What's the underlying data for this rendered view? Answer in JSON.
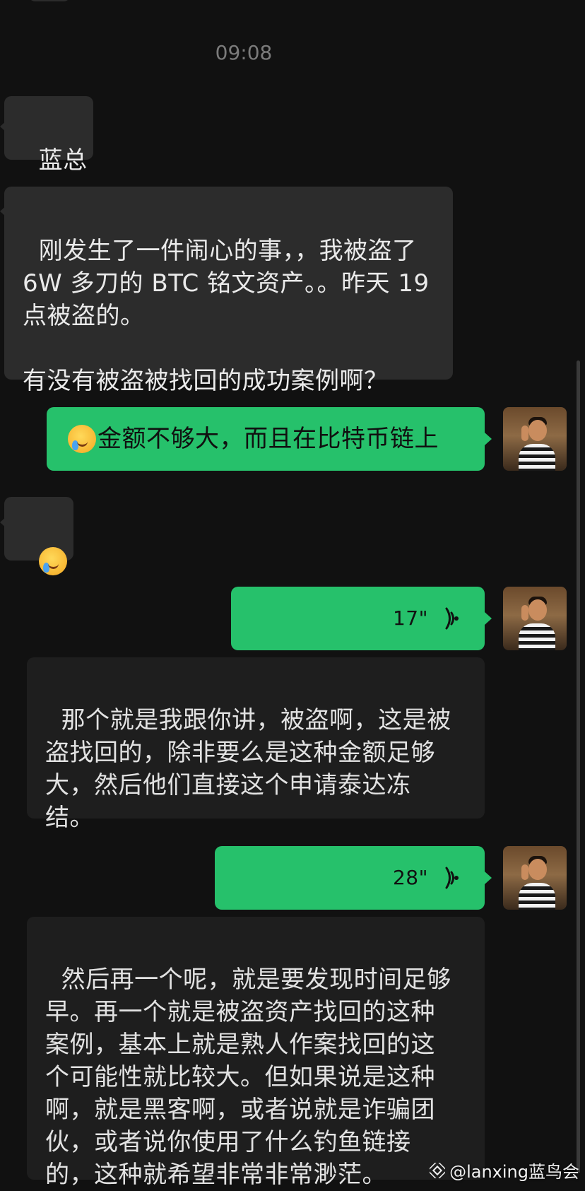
{
  "timestamp": "09:08",
  "messages": [
    {
      "side": "left",
      "text": "蓝总"
    },
    {
      "side": "left",
      "text": "刚发生了一件闹心的事，，我被盗了\n6W 多刀的 BTC 铭文资产。。昨天 19\n点被盗的。\n\n有没有被盗被找回的成功案例啊？"
    },
    {
      "side": "right",
      "emoji": "crying-laughing-emoji",
      "text": "金额不够大，而且在比特币链上"
    },
    {
      "side": "left",
      "emoji": "crying-laughing-emoji",
      "text": ""
    },
    {
      "side": "right",
      "type": "voice",
      "duration": "17\""
    },
    {
      "side": "left",
      "type": "voice-transcript",
      "text": "那个就是我跟你讲，被盗啊，这是被\n盗找回的，除非要么是这种金额足够\n大，然后他们直接这个申请泰达冻\n结。"
    },
    {
      "side": "right",
      "type": "voice",
      "duration": "28\""
    },
    {
      "side": "left",
      "type": "voice-transcript",
      "text": "然后再一个呢，就是要发现时间足够\n早。再一个就是被盗资产找回的这种\n案例，基本上就是熟人作案找回的这\n个可能性就比较大。但如果说是这种\n啊，就是黑客啊，或者说就是诈骗团\n伙，或者说你使用了什么钓鱼链接\n的，这种就希望非常非常渺茫。"
    }
  ],
  "watermark": {
    "text": "@lanxing蓝鸟会",
    "icon": "binance-square-logo-icon"
  },
  "colors": {
    "background": "#111111",
    "bubble_left": "#2c2c2c",
    "bubble_transcript": "#1e1e1e",
    "bubble_right": "#26c16b",
    "timestamp": "#7b7b7b"
  }
}
